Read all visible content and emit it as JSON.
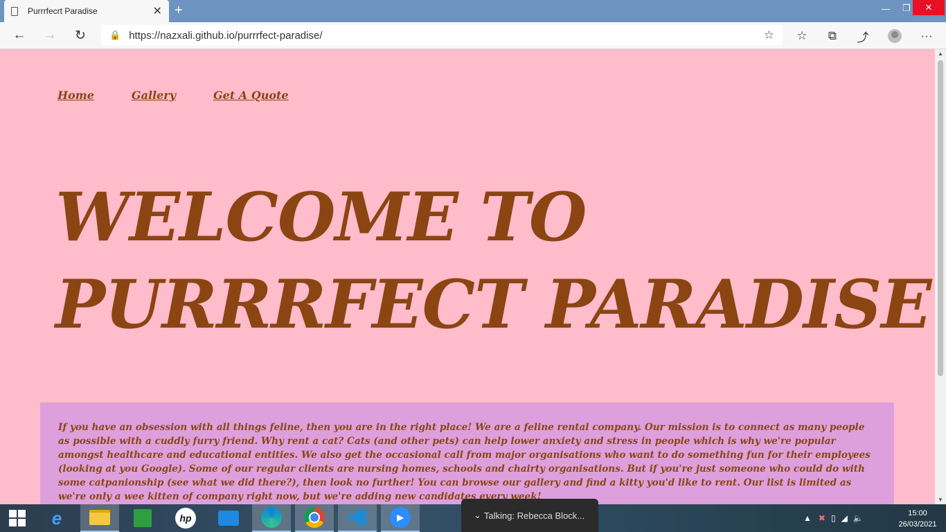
{
  "browser": {
    "tab_title": "Purrrfecrt Paradise",
    "new_tab_symbol": "+",
    "url": "https://nazxali.github.io/purrrfect-paradise/",
    "icons": {
      "back": "←",
      "forward": "→",
      "refresh": "↻",
      "lock": "🔒",
      "favorite": "☆",
      "favorites": "☆",
      "collections": "⧉",
      "share": "⤴",
      "more": "···",
      "minimize": "—",
      "restore": "❐",
      "close": "✕",
      "tab_close": "✕"
    }
  },
  "site": {
    "nav": [
      "Home",
      "Gallery",
      "Get A Quote"
    ],
    "hero_line1": "WELCOME TO",
    "hero_line2": "PURRRFECT PARADISE!",
    "intro": "If you have an obsession with all things feline, then you are in the right place! We are a feline rental company. Our mission is to connect as many people as possible with a cuddly furry friend. Why rent a cat? Cats (and other pets) can help lower anxiety and stress in people which is why we're popular amongst healthcare and educational entities. We also get the occasional call from major organisations who want to do something fun for their employees (looking at you Google). Some of our regular clients are nursing homes, schools and chairty organisations. But if you're just someone who could do with some catpanionship (see what we did there?), then look no further! You can browse our gallery and find a kitty you'd like to rent. Our list is limited as we're only a wee kitten of company right now, but we're adding new candidates every week!",
    "colors": {
      "background": "#ffbccb",
      "text": "#8b4513",
      "intro_box": "#dda0dd"
    }
  },
  "taskbar": {
    "notification": "Talking: Rebecca Block...",
    "notification_icon": "⌄",
    "time": "15:00",
    "date": "26/03/2021",
    "apps": [
      "start",
      "internet-explorer",
      "file-explorer",
      "store",
      "hp",
      "onedrive",
      "edge",
      "chrome",
      "vscode",
      "zoom"
    ]
  }
}
